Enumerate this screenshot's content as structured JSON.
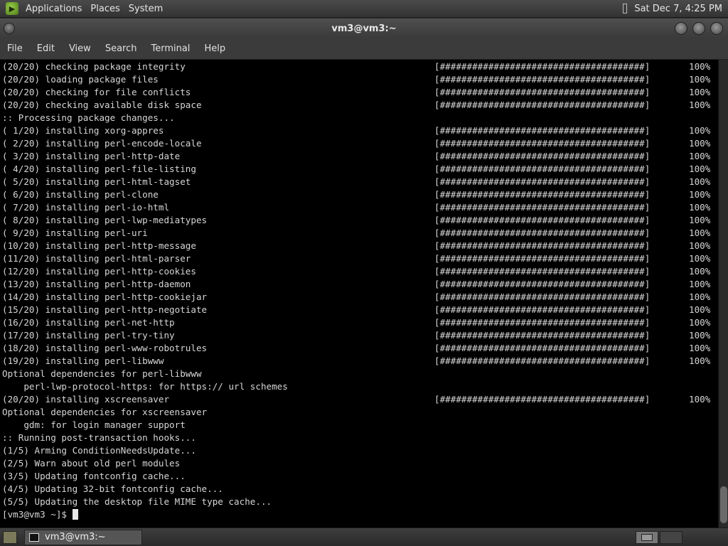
{
  "top_panel": {
    "menus": [
      "Applications",
      "Places",
      "System"
    ],
    "clock": "Sat Dec 7, 4:25 PM"
  },
  "window": {
    "title": "vm3@vm3:~",
    "menu": [
      "File",
      "Edit",
      "View",
      "Search",
      "Terminal",
      "Help"
    ]
  },
  "terminal": {
    "lines": [
      {
        "text": "(20/20) checking package integrity",
        "bar": "[######################################]",
        "pct": "100%"
      },
      {
        "text": "(20/20) loading package files",
        "bar": "[######################################]",
        "pct": "100%"
      },
      {
        "text": "(20/20) checking for file conflicts",
        "bar": "[######################################]",
        "pct": "100%"
      },
      {
        "text": "(20/20) checking available disk space",
        "bar": "[######################################]",
        "pct": "100%"
      },
      {
        "text": ":: Processing package changes...",
        "bar": "",
        "pct": ""
      },
      {
        "text": "( 1/20) installing xorg-appres",
        "bar": "[######################################]",
        "pct": "100%"
      },
      {
        "text": "( 2/20) installing perl-encode-locale",
        "bar": "[######################################]",
        "pct": "100%"
      },
      {
        "text": "( 3/20) installing perl-http-date",
        "bar": "[######################################]",
        "pct": "100%"
      },
      {
        "text": "( 4/20) installing perl-file-listing",
        "bar": "[######################################]",
        "pct": "100%"
      },
      {
        "text": "( 5/20) installing perl-html-tagset",
        "bar": "[######################################]",
        "pct": "100%"
      },
      {
        "text": "( 6/20) installing perl-clone",
        "bar": "[######################################]",
        "pct": "100%"
      },
      {
        "text": "( 7/20) installing perl-io-html",
        "bar": "[######################################]",
        "pct": "100%"
      },
      {
        "text": "( 8/20) installing perl-lwp-mediatypes",
        "bar": "[######################################]",
        "pct": "100%"
      },
      {
        "text": "( 9/20) installing perl-uri",
        "bar": "[######################################]",
        "pct": "100%"
      },
      {
        "text": "(10/20) installing perl-http-message",
        "bar": "[######################################]",
        "pct": "100%"
      },
      {
        "text": "(11/20) installing perl-html-parser",
        "bar": "[######################################]",
        "pct": "100%"
      },
      {
        "text": "(12/20) installing perl-http-cookies",
        "bar": "[######################################]",
        "pct": "100%"
      },
      {
        "text": "(13/20) installing perl-http-daemon",
        "bar": "[######################################]",
        "pct": "100%"
      },
      {
        "text": "(14/20) installing perl-http-cookiejar",
        "bar": "[######################################]",
        "pct": "100%"
      },
      {
        "text": "(15/20) installing perl-http-negotiate",
        "bar": "[######################################]",
        "pct": "100%"
      },
      {
        "text": "(16/20) installing perl-net-http",
        "bar": "[######################################]",
        "pct": "100%"
      },
      {
        "text": "(17/20) installing perl-try-tiny",
        "bar": "[######################################]",
        "pct": "100%"
      },
      {
        "text": "(18/20) installing perl-www-robotrules",
        "bar": "[######################################]",
        "pct": "100%"
      },
      {
        "text": "(19/20) installing perl-libwww",
        "bar": "[######################################]",
        "pct": "100%"
      },
      {
        "text": "Optional dependencies for perl-libwww",
        "bar": "",
        "pct": ""
      },
      {
        "text": "    perl-lwp-protocol-https: for https:// url schemes",
        "bar": "",
        "pct": ""
      },
      {
        "text": "(20/20) installing xscreensaver",
        "bar": "[######################################]",
        "pct": "100%"
      },
      {
        "text": "Optional dependencies for xscreensaver",
        "bar": "",
        "pct": ""
      },
      {
        "text": "    gdm: for login manager support",
        "bar": "",
        "pct": ""
      },
      {
        "text": ":: Running post-transaction hooks...",
        "bar": "",
        "pct": ""
      },
      {
        "text": "(1/5) Arming ConditionNeedsUpdate...",
        "bar": "",
        "pct": ""
      },
      {
        "text": "(2/5) Warn about old perl modules",
        "bar": "",
        "pct": ""
      },
      {
        "text": "(3/5) Updating fontconfig cache...",
        "bar": "",
        "pct": ""
      },
      {
        "text": "(4/5) Updating 32-bit fontconfig cache...",
        "bar": "",
        "pct": ""
      },
      {
        "text": "(5/5) Updating the desktop file MIME type cache...",
        "bar": "",
        "pct": ""
      }
    ],
    "prompt": "[vm3@vm3 ~]$ "
  },
  "taskbar": {
    "task_label": "vm3@vm3:~"
  },
  "colors": {
    "terminal_bg": "#000000",
    "terminal_fg": "#d6d6d6",
    "panel_bg": "#3b3b3b"
  }
}
